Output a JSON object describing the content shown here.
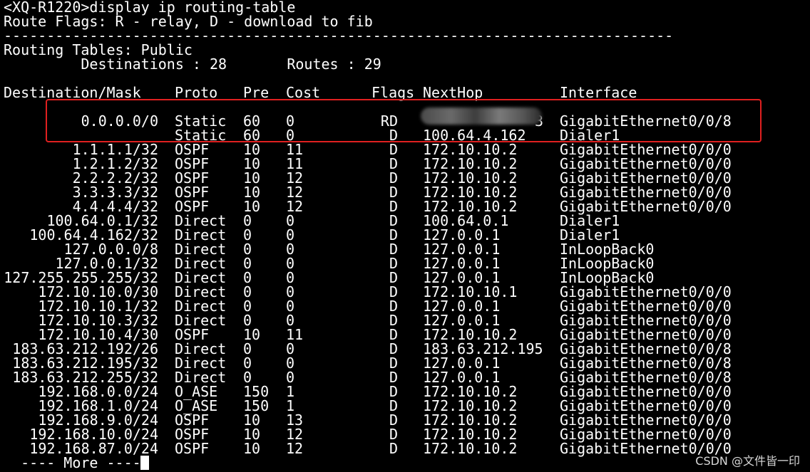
{
  "prompt_line": "<XQ-R1220>display ip routing-table",
  "flags_line": "Route Flags: R - relay, D - download to fib",
  "separator": "------------------------------------------------------------------------------",
  "table_title": "Routing Tables: Public",
  "summary_line": "         Destinations : 28       Routes : 29",
  "headers": {
    "dest": "Destination/Mask",
    "proto": "Proto",
    "pre": "Pre",
    "cost": "Cost",
    "flags": "Flags",
    "nexthop": "NextHop",
    "iface": "Interface"
  },
  "routes": [
    {
      "dest": "0.0.0.0/0",
      "proto": "Static",
      "pre": "60",
      "cost": "0",
      "flags": "RD",
      "nexthop": "3",
      "iface": "GigabitEthernet0/0/8"
    },
    {
      "dest": "",
      "proto": "Static",
      "pre": "60",
      "cost": "0",
      "flags": "D",
      "nexthop": "100.64.4.162",
      "iface": "Dialer1"
    },
    {
      "dest": "1.1.1.1/32",
      "proto": "OSPF",
      "pre": "10",
      "cost": "11",
      "flags": "D",
      "nexthop": "172.10.10.2",
      "iface": "GigabitEthernet0/0/0"
    },
    {
      "dest": "1.2.1.2/32",
      "proto": "OSPF",
      "pre": "10",
      "cost": "11",
      "flags": "D",
      "nexthop": "172.10.10.2",
      "iface": "GigabitEthernet0/0/0"
    },
    {
      "dest": "2.2.2.2/32",
      "proto": "OSPF",
      "pre": "10",
      "cost": "12",
      "flags": "D",
      "nexthop": "172.10.10.2",
      "iface": "GigabitEthernet0/0/0"
    },
    {
      "dest": "3.3.3.3/32",
      "proto": "OSPF",
      "pre": "10",
      "cost": "12",
      "flags": "D",
      "nexthop": "172.10.10.2",
      "iface": "GigabitEthernet0/0/0"
    },
    {
      "dest": "4.4.4.4/32",
      "proto": "OSPF",
      "pre": "10",
      "cost": "12",
      "flags": "D",
      "nexthop": "172.10.10.2",
      "iface": "GigabitEthernet0/0/0"
    },
    {
      "dest": "100.64.0.1/32",
      "proto": "Direct",
      "pre": "0",
      "cost": "0",
      "flags": "D",
      "nexthop": "100.64.0.1",
      "iface": "Dialer1"
    },
    {
      "dest": "100.64.4.162/32",
      "proto": "Direct",
      "pre": "0",
      "cost": "0",
      "flags": "D",
      "nexthop": "127.0.0.1",
      "iface": "Dialer1"
    },
    {
      "dest": "127.0.0.0/8",
      "proto": "Direct",
      "pre": "0",
      "cost": "0",
      "flags": "D",
      "nexthop": "127.0.0.1",
      "iface": "InLoopBack0"
    },
    {
      "dest": "127.0.0.1/32",
      "proto": "Direct",
      "pre": "0",
      "cost": "0",
      "flags": "D",
      "nexthop": "127.0.0.1",
      "iface": "InLoopBack0"
    },
    {
      "dest": "127.255.255.255/32",
      "proto": "Direct",
      "pre": "0",
      "cost": "0",
      "flags": "D",
      "nexthop": "127.0.0.1",
      "iface": "InLoopBack0"
    },
    {
      "dest": "172.10.10.0/30",
      "proto": "Direct",
      "pre": "0",
      "cost": "0",
      "flags": "D",
      "nexthop": "172.10.10.1",
      "iface": "GigabitEthernet0/0/0"
    },
    {
      "dest": "172.10.10.1/32",
      "proto": "Direct",
      "pre": "0",
      "cost": "0",
      "flags": "D",
      "nexthop": "127.0.0.1",
      "iface": "GigabitEthernet0/0/0"
    },
    {
      "dest": "172.10.10.3/32",
      "proto": "Direct",
      "pre": "0",
      "cost": "0",
      "flags": "D",
      "nexthop": "127.0.0.1",
      "iface": "GigabitEthernet0/0/0"
    },
    {
      "dest": "172.10.10.4/30",
      "proto": "OSPF",
      "pre": "10",
      "cost": "11",
      "flags": "D",
      "nexthop": "172.10.10.2",
      "iface": "GigabitEthernet0/0/0"
    },
    {
      "dest": "183.63.212.192/26",
      "proto": "Direct",
      "pre": "0",
      "cost": "0",
      "flags": "D",
      "nexthop": "183.63.212.195",
      "iface": "GigabitEthernet0/0/8"
    },
    {
      "dest": "183.63.212.195/32",
      "proto": "Direct",
      "pre": "0",
      "cost": "0",
      "flags": "D",
      "nexthop": "127.0.0.1",
      "iface": "GigabitEthernet0/0/8"
    },
    {
      "dest": "183.63.212.255/32",
      "proto": "Direct",
      "pre": "0",
      "cost": "0",
      "flags": "D",
      "nexthop": "127.0.0.1",
      "iface": "GigabitEthernet0/0/8"
    },
    {
      "dest": "192.168.0.0/24",
      "proto": "O_ASE",
      "pre": "150",
      "cost": "1",
      "flags": "D",
      "nexthop": "172.10.10.2",
      "iface": "GigabitEthernet0/0/0"
    },
    {
      "dest": "192.168.1.0/24",
      "proto": "O_ASE",
      "pre": "150",
      "cost": "1",
      "flags": "D",
      "nexthop": "172.10.10.2",
      "iface": "GigabitEthernet0/0/0"
    },
    {
      "dest": "192.168.9.0/24",
      "proto": "OSPF",
      "pre": "10",
      "cost": "13",
      "flags": "D",
      "nexthop": "172.10.10.2",
      "iface": "GigabitEthernet0/0/0"
    },
    {
      "dest": "192.168.10.0/24",
      "proto": "OSPF",
      "pre": "10",
      "cost": "12",
      "flags": "D",
      "nexthop": "172.10.10.2",
      "iface": "GigabitEthernet0/0/0"
    },
    {
      "dest": "192.168.87.0/24",
      "proto": "OSPF",
      "pre": "10",
      "cost": "12",
      "flags": "D",
      "nexthop": "172.10.10.2",
      "iface": "GigabitEthernet0/0/0"
    }
  ],
  "more_prompt": "  ---- More ----",
  "watermark": "CSDN @文件皆一印",
  "colors": {
    "background": "#000000",
    "text": "#ffffff",
    "highlight": "#e02020"
  }
}
